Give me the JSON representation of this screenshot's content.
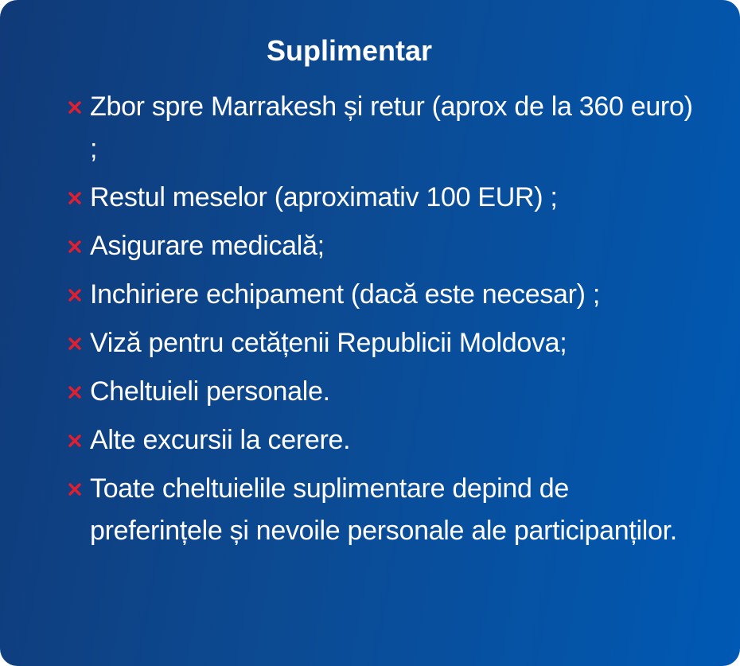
{
  "card": {
    "title": "Suplimentar",
    "items": [
      {
        "text": "Zbor spre Marrakesh și retur (aprox de la 360 euro) ;",
        "icon": "cross-icon"
      },
      {
        "text": "Restul meselor (aproximativ 100 EUR) ;",
        "icon": "cross-icon"
      },
      {
        "text": "Asigurare medicală;",
        "icon": "cross-icon"
      },
      {
        "text": "Inchiriere echipament (dacă este necesar) ;",
        "icon": "cross-icon"
      },
      {
        "text": "Viză pentru cetățenii Republicii Moldova;",
        "icon": "cross-icon"
      },
      {
        "text": "Cheltuieli personale.",
        "icon": "cross-icon"
      },
      {
        "text": "Alte excursii la cerere.",
        "icon": "cross-icon"
      },
      {
        "text": "Toate cheltuielile suplimentare depind de preferințele și nevoile personale ale participanților.",
        "icon": "cross-icon"
      }
    ]
  },
  "colors": {
    "icon": "#e41e2f",
    "text": "#ffffff",
    "gradient_start": "#103a78",
    "gradient_end": "#0059b4"
  }
}
